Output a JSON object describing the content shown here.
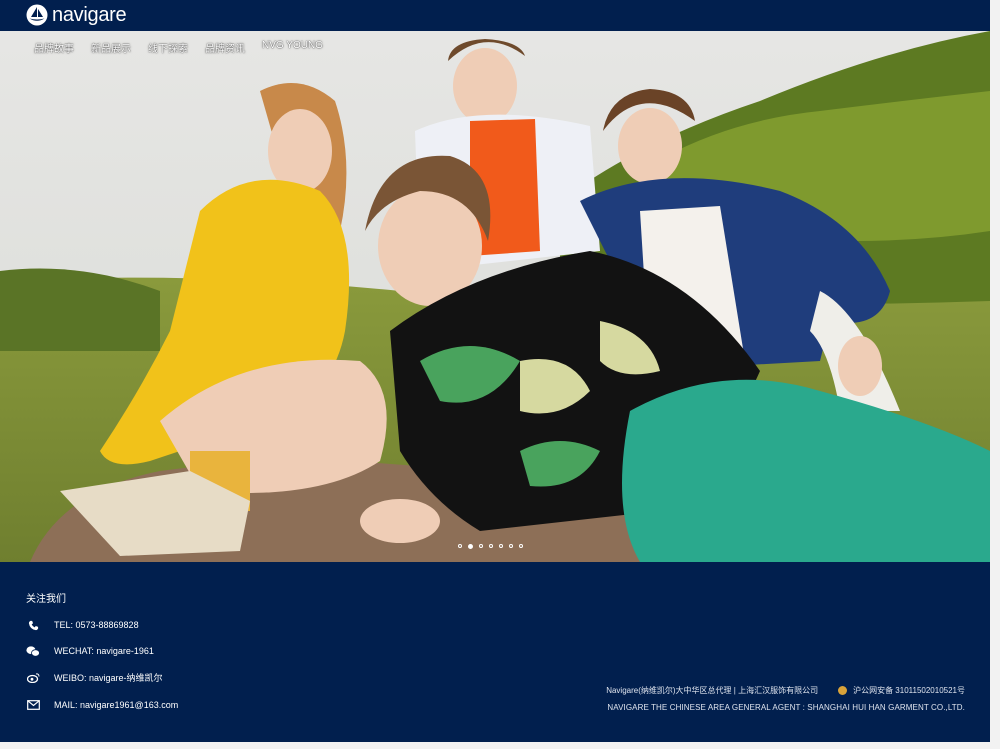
{
  "brand": {
    "name": "navigare"
  },
  "nav": {
    "items": [
      {
        "label": "品牌故事"
      },
      {
        "label": "新品展示"
      },
      {
        "label": "线下探索"
      },
      {
        "label": "品牌资讯"
      },
      {
        "label": "NVG YOUNG"
      }
    ]
  },
  "carousel": {
    "slide_count": 7,
    "active_index": 1
  },
  "footer": {
    "follow_title": "关注我们",
    "contacts": [
      {
        "icon": "phone-icon",
        "text": "TEL: 0573-88869828"
      },
      {
        "icon": "wechat-icon",
        "text": "WECHAT: navigare-1961"
      },
      {
        "icon": "weibo-icon",
        "text": "WEIBO: navigare-纳维凯尔"
      },
      {
        "icon": "mail-icon",
        "text": "MAIL: navigare1961@163.com"
      }
    ],
    "agent_cn": "Navigare(纳维凯尔)大中华区总代理 | 上海汇汉服饰有限公司",
    "icp": "沪公网安备 31011502010521号",
    "agent_en": "NAVIGARE THE CHINESE AREA GENERAL AGENT : SHANGHAI HUI HAN GARMENT CO.,LTD."
  },
  "colors": {
    "navy": "#011f4e",
    "white": "#ffffff"
  }
}
